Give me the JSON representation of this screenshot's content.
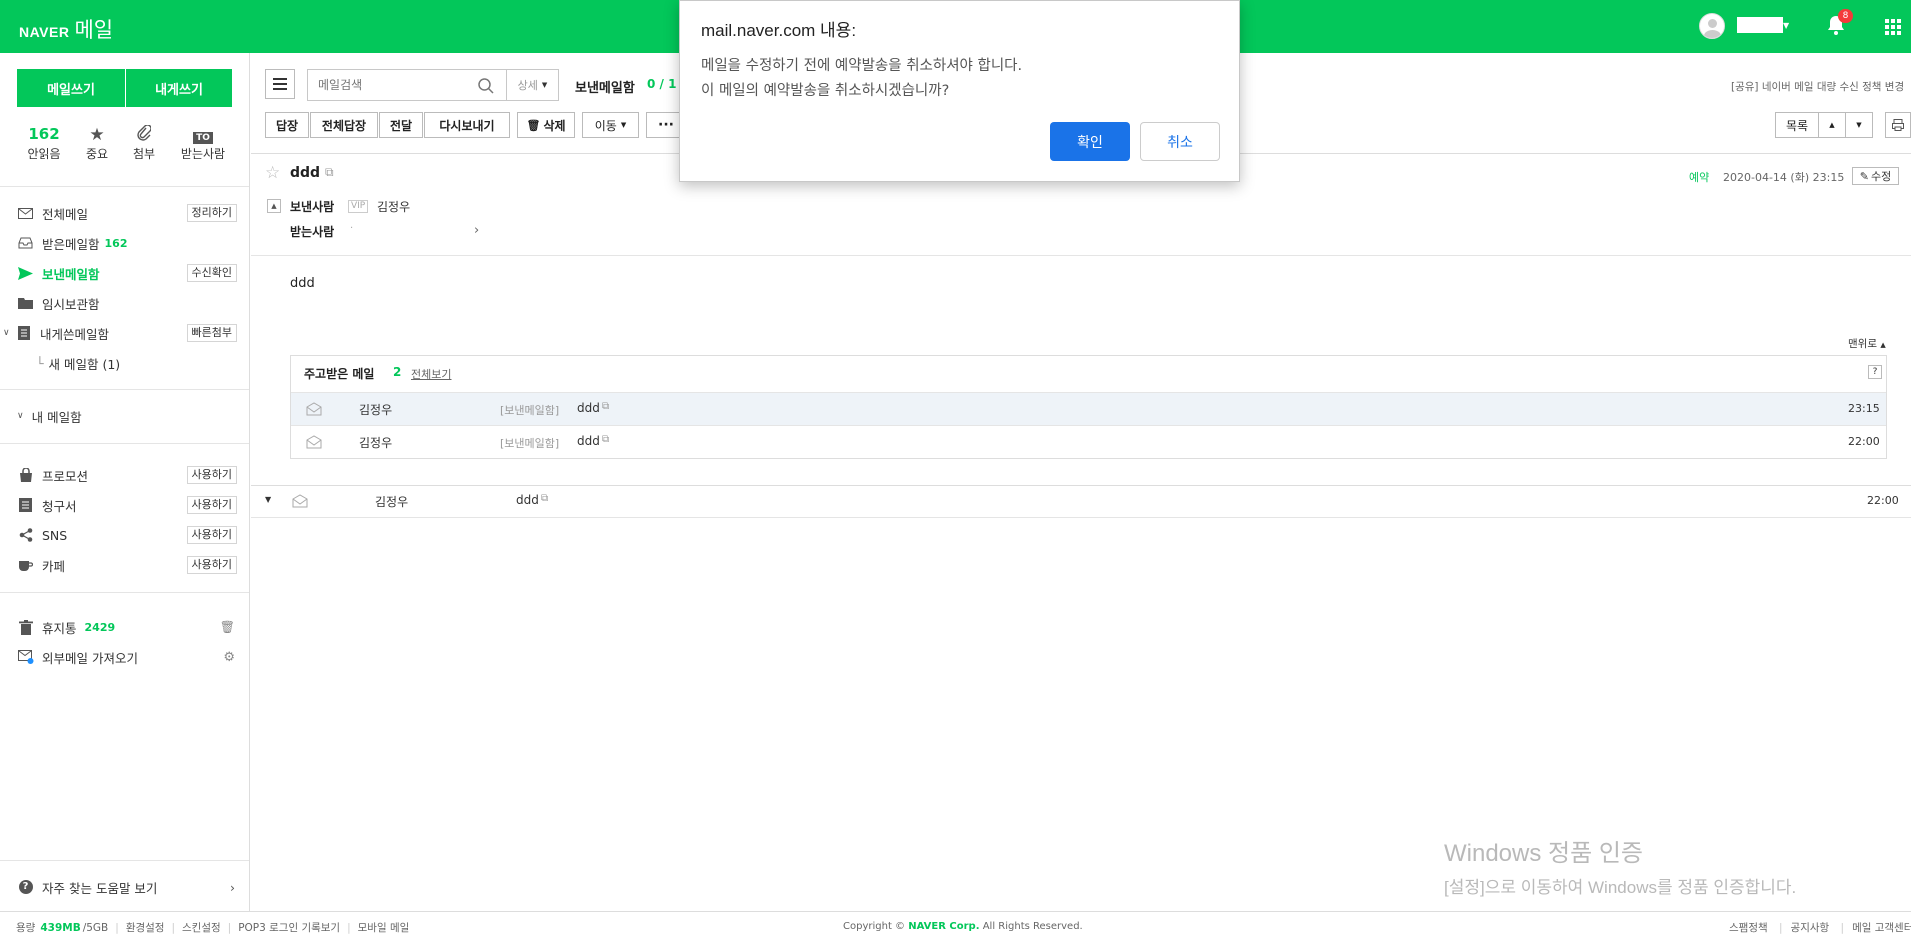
{
  "topbar": {
    "brand": "NAVER",
    "product": "메일",
    "notification_count": "8"
  },
  "sidebar": {
    "write_button": "메일쓰기",
    "self_write_button": "내게쓰기",
    "quick": [
      {
        "value": "162",
        "label": "안읽음"
      },
      {
        "label": "중요"
      },
      {
        "label": "첨부"
      },
      {
        "label": "받는사람"
      }
    ],
    "folders": [
      {
        "label": "전체메일",
        "action": "정리하기"
      },
      {
        "label": "받은메일함",
        "count": "162"
      },
      {
        "label": "보낸메일함",
        "action": "수신확인"
      },
      {
        "label": "임시보관함"
      },
      {
        "label": "내게쓴메일함",
        "action": "빠른첨부"
      },
      {
        "label": "새 메일함 (1)"
      }
    ],
    "my_folder": "내 메일함",
    "apps": [
      {
        "label": "프로모션",
        "action": "사용하기"
      },
      {
        "label": "청구서",
        "action": "사용하기"
      },
      {
        "label": "SNS",
        "action": "사용하기"
      },
      {
        "label": "카페",
        "action": "사용하기"
      }
    ],
    "trash": {
      "label": "휴지통",
      "count": "2429"
    },
    "external": "외부메일 가져오기",
    "help": "자주 찾는 도움말 보기"
  },
  "toolbar": {
    "search_placeholder": "메일검색",
    "search_detail": "상세",
    "folder_name": "보낸메일함",
    "folder_count": "0 / 1",
    "policy_link": "[공유] 네이버 메일 대량 수신 정책 변경",
    "reply": "답장",
    "reply_all": "전체답장",
    "forward": "전달",
    "resend": "다시보내기",
    "delete": "삭제",
    "move": "이동",
    "more": "···",
    "list": "목록"
  },
  "message": {
    "subject": "ddd",
    "reserved_label": "예약",
    "date": "2020-04-14 (화) 23:15",
    "edit_button": "수정",
    "sender_label": "보낸사람",
    "vip_badge": "VIP",
    "sender_name": "김정우",
    "recipient_label": "받는사람",
    "body": "ddd",
    "to_top": "맨위로"
  },
  "thread": {
    "title": "주고받은 메일",
    "count": "2",
    "view_all": "전체보기",
    "help": "?",
    "rows": [
      {
        "sender": "김정우",
        "folder": "[보낸메일함]",
        "subject": "ddd",
        "time": "23:15"
      },
      {
        "sender": "김정우",
        "folder": "[보낸메일함]",
        "subject": "ddd",
        "time": "22:00"
      }
    ]
  },
  "next_mail": {
    "sender": "김정우",
    "subject": "ddd",
    "time": "22:00"
  },
  "dialog": {
    "title": "mail.naver.com 내용:",
    "line1": "메일을 수정하기 전에 예약발송을 취소하셔야 합니다.",
    "line2": "이 메일의 예약발송을 취소하시겠습니까?",
    "ok": "확인",
    "cancel": "취소"
  },
  "watermark": {
    "line1": "Windows 정품 인증",
    "line2": "[설정]으로 이동하여 Windows를 정품 인증합니다."
  },
  "footer": {
    "storage_label": "용량",
    "storage_used": "439MB",
    "storage_total": "/5GB",
    "links": [
      "환경설정",
      "스킨설정",
      "POP3 로그인 기록보기",
      "모바일 메일"
    ],
    "copyright_pre": "Copyright ©",
    "copyright_corp": "NAVER Corp.",
    "copyright_post": "All Rights Reserved.",
    "right_links": [
      "스팸정책",
      "공지사항",
      "메일 고객센터"
    ]
  },
  "colors": {
    "brand_green": "#03c75a",
    "button_blue": "#1a73e8"
  }
}
